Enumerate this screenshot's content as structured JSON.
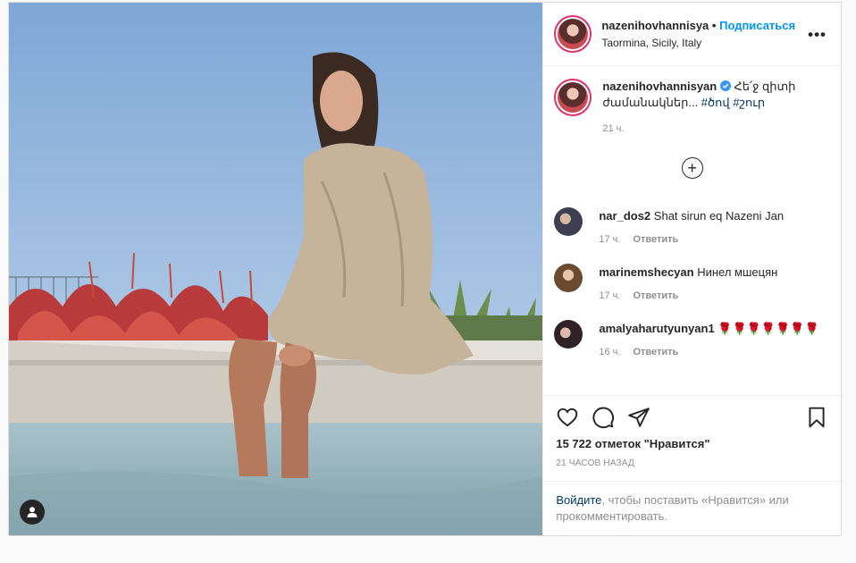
{
  "header": {
    "username": "nazenihovhannisya",
    "separator": "•",
    "follow_label": "Подписаться",
    "location": "Taormina, Sicily, Italy",
    "more_label": "•••"
  },
  "caption": {
    "username": "nazenihovhannisyan",
    "text": "Հե՛ջ զիտի ժամանակներ...",
    "hashtags": [
      "#ծով",
      "#շուր"
    ],
    "time": "21 ч."
  },
  "load_more_label": "+",
  "comments": [
    {
      "username": "nar_dos2",
      "text": "Shat sirun eq Nazeni Jan",
      "time": "17 ч.",
      "reply": "Ответить"
    },
    {
      "username": "marinemshecyan",
      "text": "Нинел мшецян",
      "time": "17 ч.",
      "reply": "Ответить"
    },
    {
      "username": "amalyaharutyunyan1",
      "text": "🌹🌹🌹🌹🌹🌹🌹",
      "time": "16 ч.",
      "reply": "Ответить"
    }
  ],
  "actions": {
    "likes": "15 722 отметок \"Нравится\"",
    "timestamp": "21 часов назад"
  },
  "login_prompt": {
    "link": "Войдите",
    "rest": ", чтобы поставить «Нравится» или прокомментировать."
  },
  "colors": {
    "link_blue": "#0095f6",
    "hashtag": "#00376b",
    "muted": "#8e8e8e",
    "verified": "#3897f0"
  },
  "icons": [
    "user-tag-icon",
    "verified-icon",
    "heart-icon",
    "comment-icon",
    "share-icon",
    "bookmark-icon",
    "plus-circle-icon",
    "more-icon"
  ]
}
